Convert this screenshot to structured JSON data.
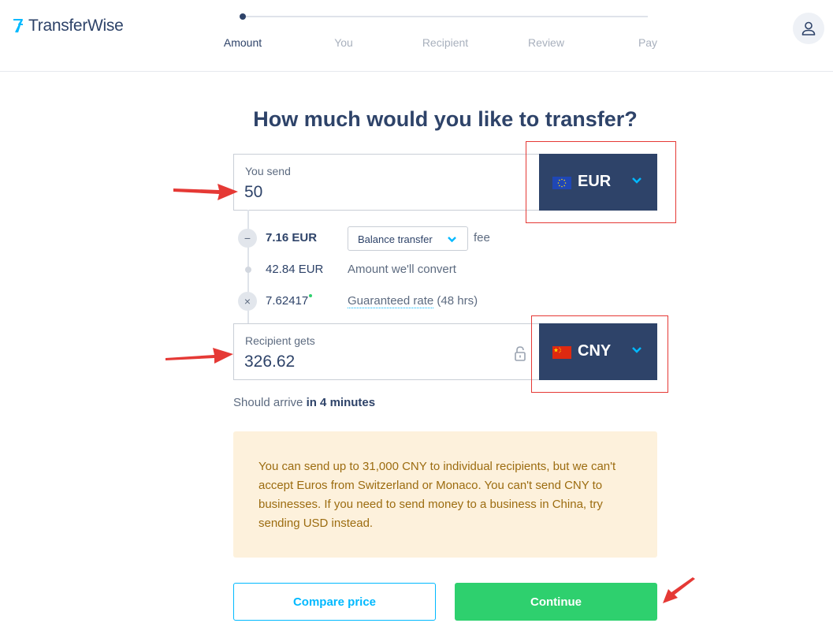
{
  "header": {
    "brand": "TransferWise",
    "steps": [
      "Amount",
      "You",
      "Recipient",
      "Review",
      "Pay"
    ],
    "active_step": "Amount"
  },
  "main": {
    "title": "How much would you like to transfer?",
    "send": {
      "label": "You send",
      "value": "50",
      "currency": "EUR"
    },
    "fee": {
      "amount": "7.16 EUR",
      "method": "Balance transfer",
      "suffix": "fee"
    },
    "convert": {
      "amount": "42.84 EUR",
      "label": "Amount we'll convert"
    },
    "rate": {
      "value": "7.62417",
      "link": "Guaranteed rate",
      "duration": "(48 hrs)"
    },
    "receive": {
      "label": "Recipient gets",
      "value": "326.62",
      "currency": "CNY"
    },
    "arrival": {
      "prefix": "Should arrive",
      "eta": "in 4 minutes"
    },
    "notice": "You can send up to 31,000 CNY to individual recipients, but we can't accept Euros from Switzerland or Monaco. You can't send CNY to businesses. If you need to send money to a business in China, try sending USD instead.",
    "buttons": {
      "compare": "Compare price",
      "continue": "Continue"
    }
  },
  "colors": {
    "navy": "#2e4369",
    "accent_blue": "#00b9ff",
    "green": "#2ed06e",
    "notice_bg": "#fdf1dc",
    "annotation_red": "#e53935"
  },
  "icons": [
    "transferwise-logo-icon",
    "user-icon",
    "eu-flag-icon",
    "china-flag-icon",
    "chevron-down-icon",
    "lock-icon",
    "minus-icon",
    "times-icon",
    "annotation-arrow"
  ]
}
